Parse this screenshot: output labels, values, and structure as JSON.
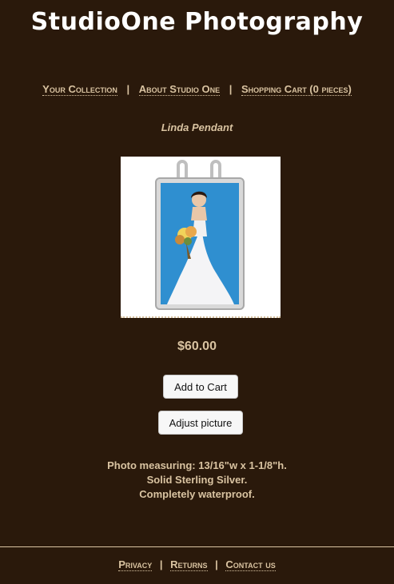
{
  "site": {
    "title": "StudioOne Photography"
  },
  "nav": {
    "items": [
      {
        "label": "Your Collection"
      },
      {
        "label": "About Studio One"
      },
      {
        "label": "Shopping Cart (0 pieces)"
      }
    ],
    "separator": "|"
  },
  "product": {
    "name": "Linda Pendant",
    "price": "$60.00",
    "add_to_cart_label": "Add to Cart",
    "adjust_picture_label": "Adjust picture",
    "description": [
      "Photo measuring: 13/16\"w x 1-1/8\"h.",
      "Solid Sterling Silver.",
      "Completely waterproof."
    ]
  },
  "footer": {
    "items": [
      {
        "label": "Privacy"
      },
      {
        "label": "Returns"
      },
      {
        "label": "Contact us"
      }
    ],
    "separator": "|"
  },
  "colors": {
    "background": "#2a190b",
    "text": "#d9c3a1",
    "title": "#ffffff"
  }
}
